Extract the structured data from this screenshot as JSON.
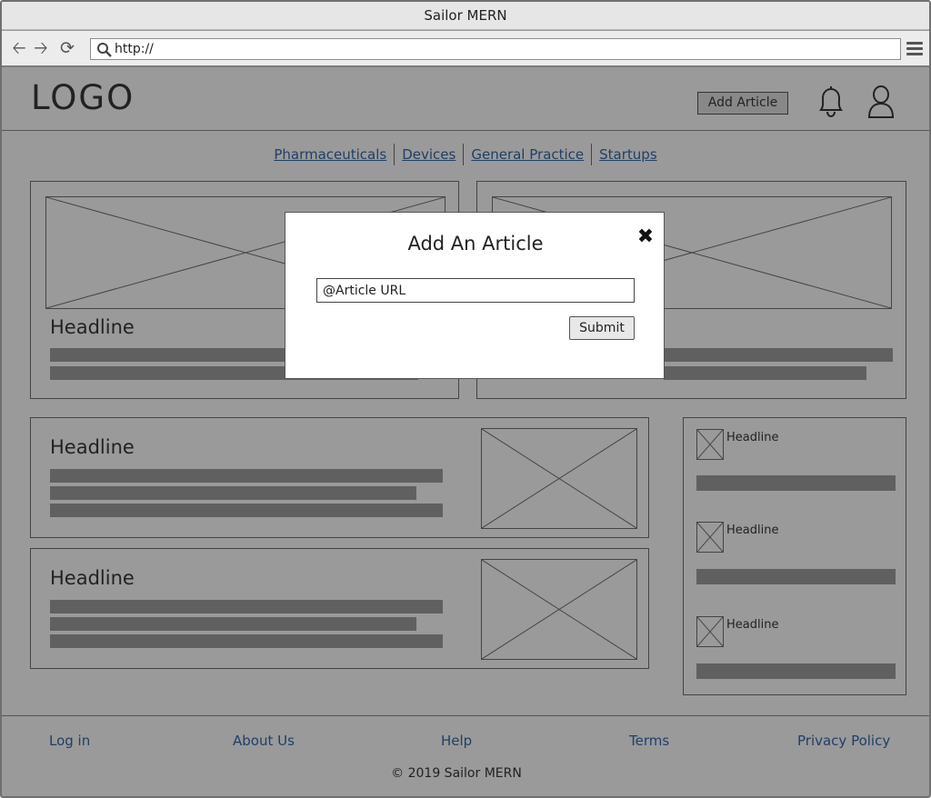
{
  "window": {
    "title": "Sailor MERN"
  },
  "browser": {
    "url": "http://"
  },
  "header": {
    "logo": "LOGO",
    "add_article_label": "Add Article"
  },
  "categories": [
    "Pharmaceuticals",
    "Devices",
    "General Practice",
    "Startups"
  ],
  "articles": {
    "featured_left": {
      "headline": "Headline"
    },
    "list": [
      {
        "headline": "Headline"
      },
      {
        "headline": "Headline"
      }
    ],
    "sidebar": [
      {
        "headline": "Headline"
      },
      {
        "headline": "Headline"
      },
      {
        "headline": "Headline"
      }
    ]
  },
  "modal": {
    "title": "Add An Article",
    "close_glyph": "✖",
    "input_value": "@Article URL",
    "submit_label": "Submit"
  },
  "footer": {
    "links": [
      "Log in",
      "About Us",
      "Help",
      "Terms",
      "Privacy Policy"
    ],
    "copyright": "© 2019 Sailor MERN"
  },
  "icons": [
    "back-arrow-icon",
    "forward-arrow-icon",
    "reload-icon",
    "search-icon",
    "menu-icon",
    "bell-icon",
    "user-icon",
    "close-icon"
  ],
  "colors": {
    "page_bg": "#9a9a9a",
    "bar": "#606060",
    "link": "#1f3f66",
    "modal_bg": "#ffffff"
  }
}
